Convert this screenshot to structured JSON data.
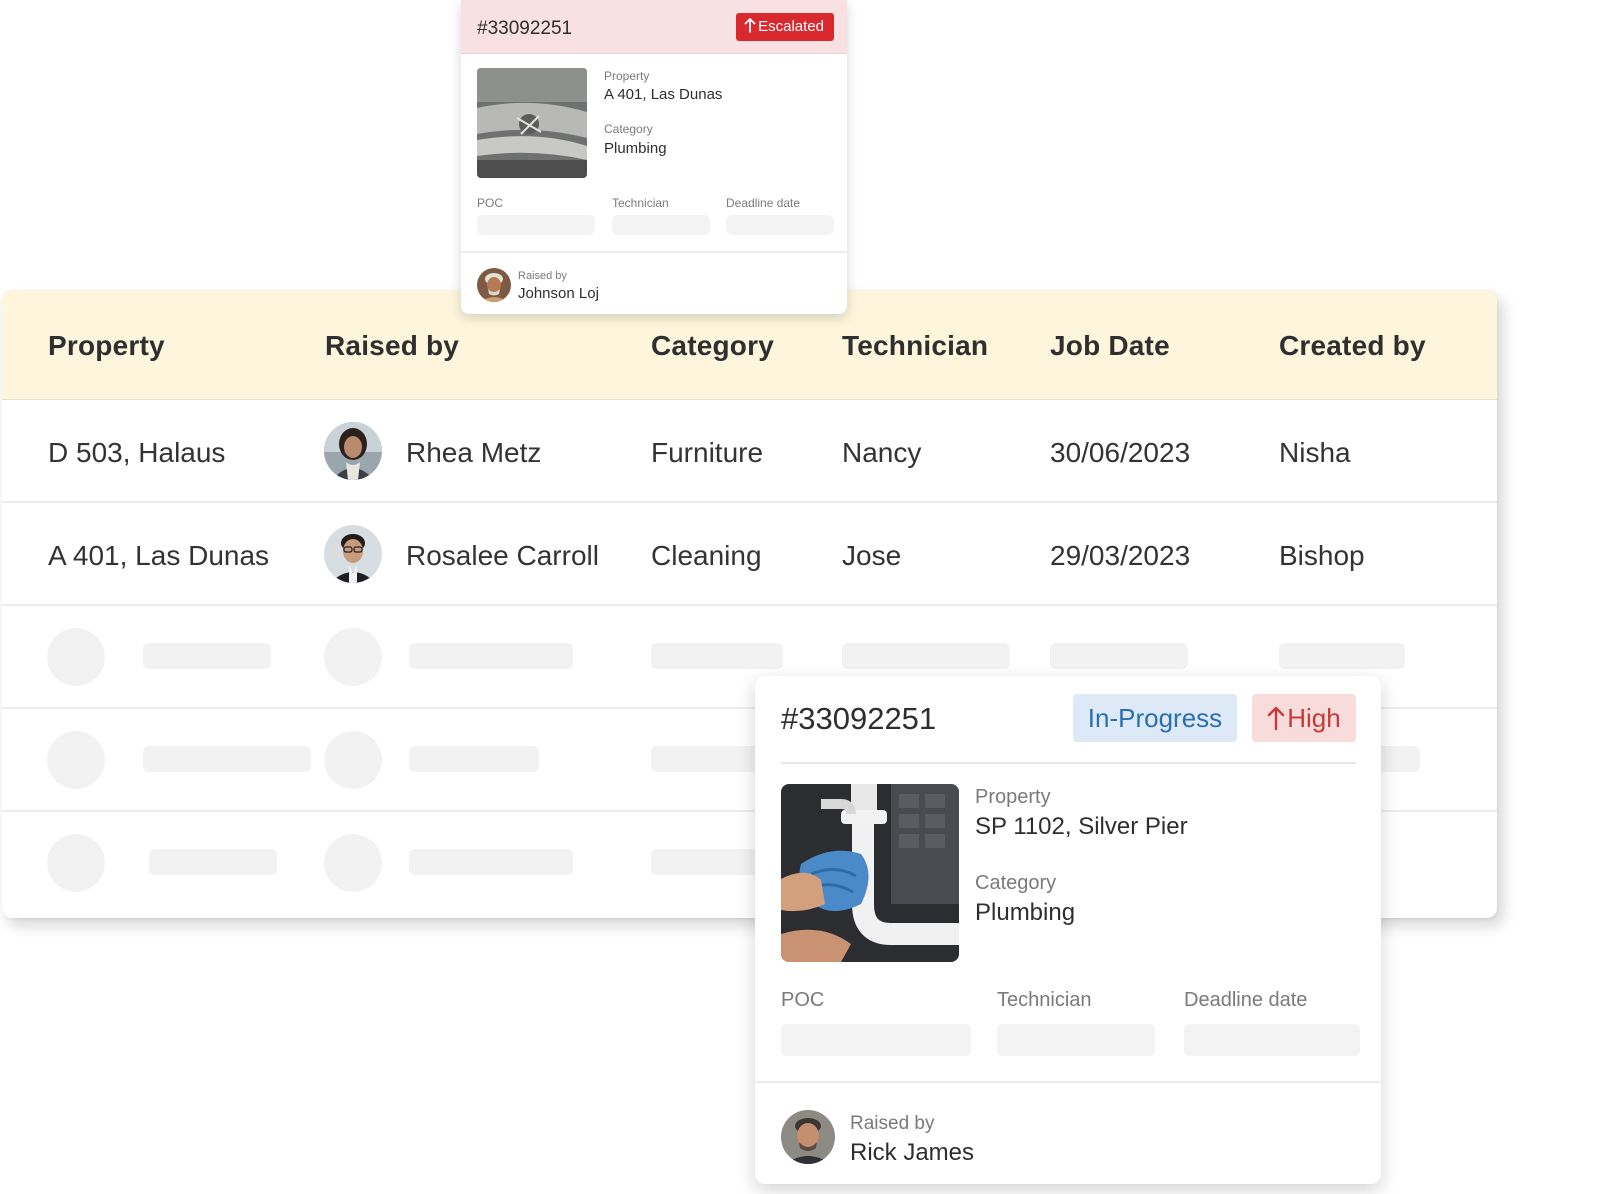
{
  "table": {
    "headers": {
      "property": "Property",
      "raised_by": "Raised by",
      "category": "Category",
      "technician": "Technician",
      "job_date": "Job Date",
      "created_by": "Created by"
    },
    "rows": [
      {
        "property": "D 503, Halaus",
        "raised_by": "Rhea Metz",
        "category": "Furniture",
        "technician": "Nancy",
        "job_date": "30/06/2023",
        "created_by": "Nisha"
      },
      {
        "property": "A 401, Las Dunas",
        "raised_by": "Rosalee Carroll",
        "category": "Cleaning",
        "technician": "Jose",
        "job_date": "29/03/2023",
        "created_by": "Bishop"
      }
    ]
  },
  "small_ticket": {
    "id": "#33092251",
    "status": "Escalated",
    "property_label": "Property",
    "property": "A 401, Las Dunas",
    "category_label": "Category",
    "category": "Plumbing",
    "poc_label": "POC",
    "technician_label": "Technician",
    "deadline_label": "Deadline date",
    "raised_by_label": "Raised by",
    "raised_by": "Johnson Loj"
  },
  "large_ticket": {
    "id": "#33092251",
    "status": "In-Progress",
    "priority": "High",
    "property_label": "Property",
    "property": "SP 1102, Silver Pier",
    "category_label": "Category",
    "category": "Plumbing",
    "poc_label": "POC",
    "technician_label": "Technician",
    "deadline_label": "Deadline date",
    "raised_by_label": "Raised by",
    "raised_by": "Rick James"
  },
  "colors": {
    "table_header_bg": "#fdf6dd",
    "escalated": "#d9292e",
    "in_progress_bg": "#dde9f7",
    "in_progress_text": "#2a6fb0",
    "high_bg": "#f8dcdc",
    "high_text": "#c63a3a"
  },
  "icons": [
    "arrow-up-icon",
    "avatar-photo",
    "plumbing-photo"
  ]
}
